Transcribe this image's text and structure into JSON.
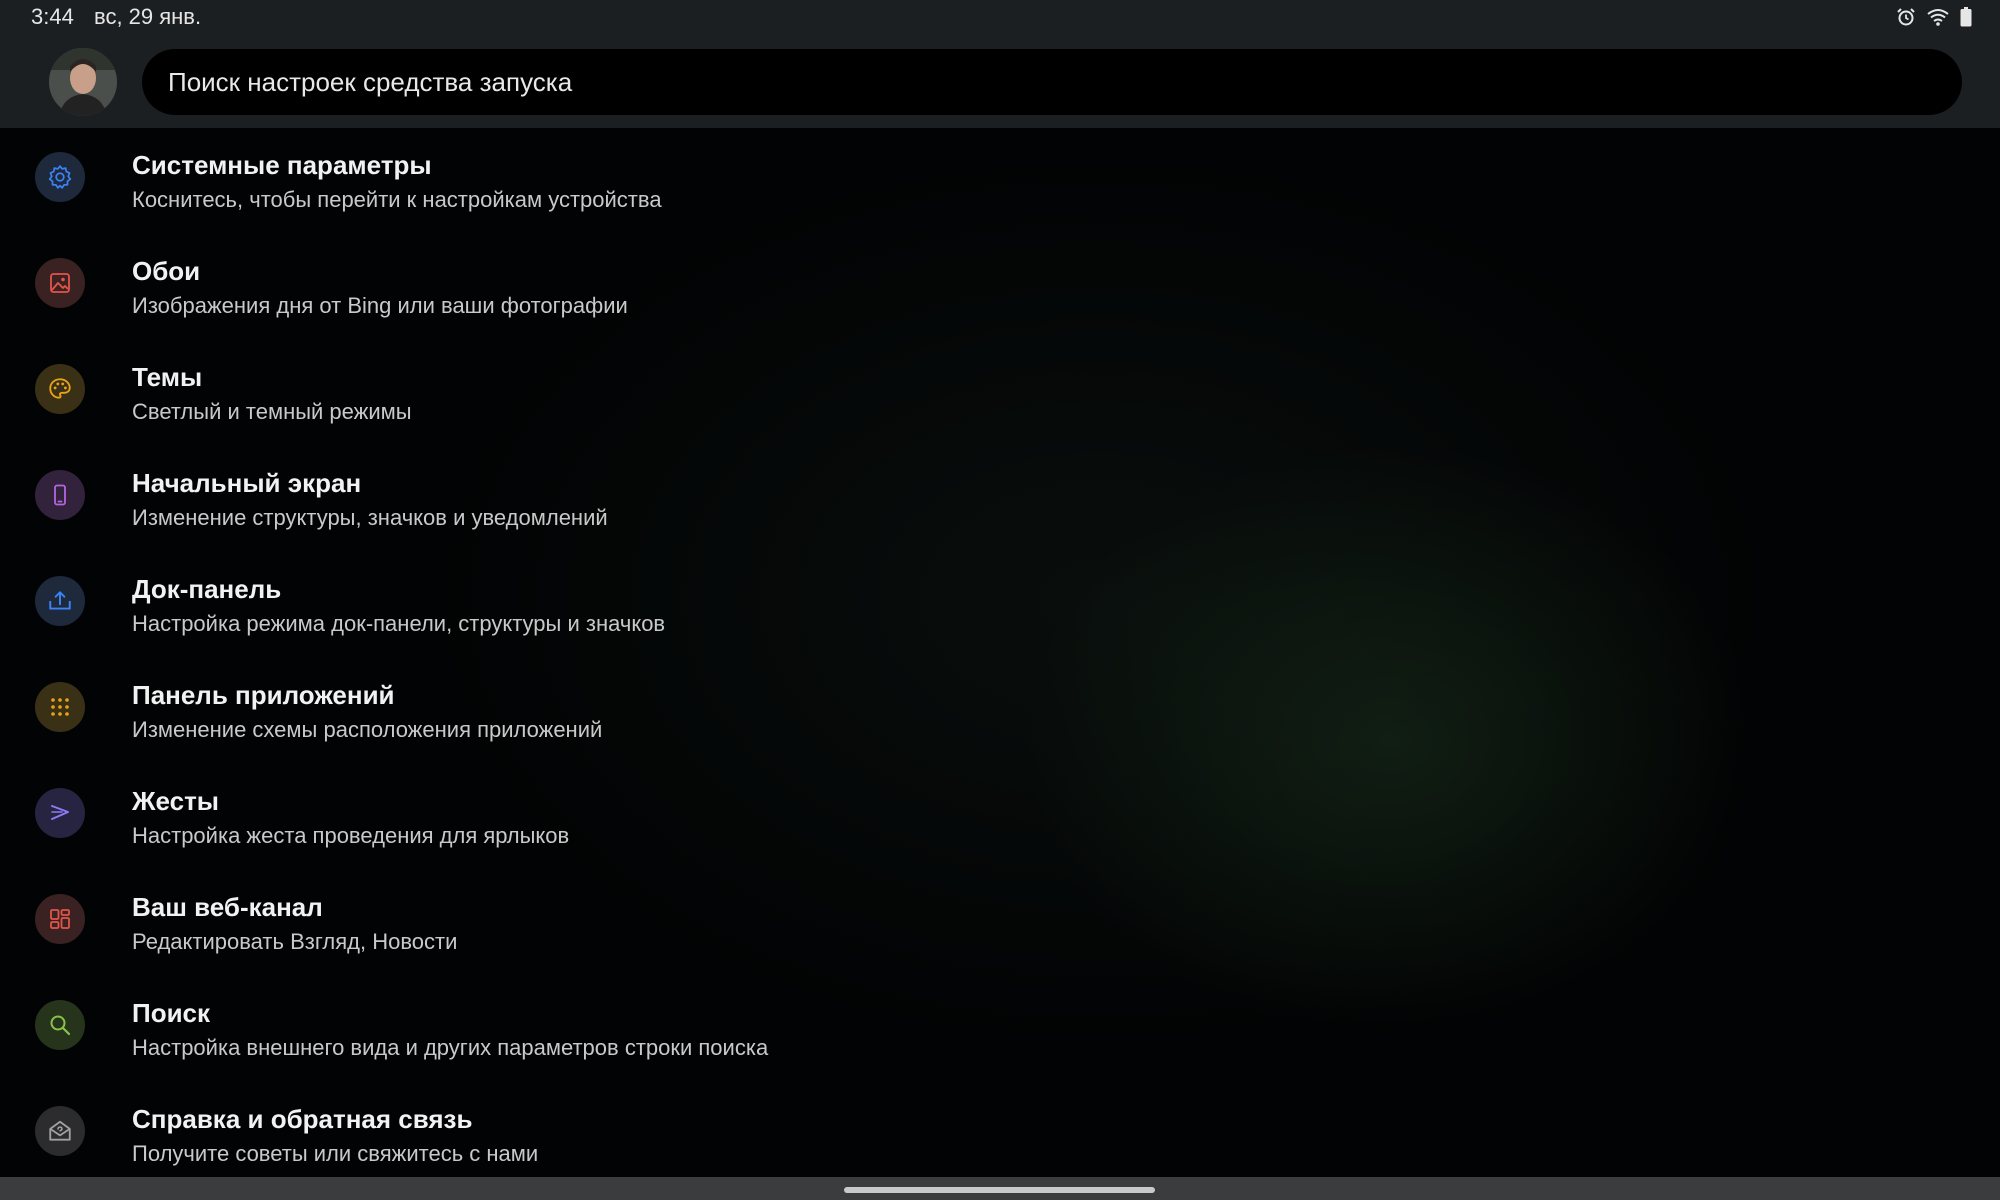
{
  "status_bar": {
    "time": "3:44",
    "date": "вс, 29 янв."
  },
  "search": {
    "placeholder": "Поиск настроек средства запуска"
  },
  "items": [
    {
      "title": "Системные параметры",
      "subtitle": "Коснитесь, чтобы перейти к настройкам устройства",
      "icon": "gear-icon",
      "color": "#3b82f6",
      "bg": "#1e2a3c"
    },
    {
      "title": "Обои",
      "subtitle": "Изображения дня от Bing или ваши фотографии",
      "icon": "image-icon",
      "color": "#e2554a",
      "bg": "#3a2222"
    },
    {
      "title": "Темы",
      "subtitle": "Светлый и темный режимы",
      "icon": "palette-icon",
      "color": "#e8a317",
      "bg": "#3a3016"
    },
    {
      "title": "Начальный экран",
      "subtitle": "Изменение структуры, значков и уведомлений",
      "icon": "phone-icon",
      "color": "#b366e0",
      "bg": "#32223c"
    },
    {
      "title": "Док-панель",
      "subtitle": "Настройка режима док-панели, структуры и значков",
      "icon": "upload-tray-icon",
      "color": "#3b82f6",
      "bg": "#1e2a3c"
    },
    {
      "title": "Панель приложений",
      "subtitle": "Изменение схемы расположения приложений",
      "icon": "grid-dots-icon",
      "color": "#e8a317",
      "bg": "#3a3016"
    },
    {
      "title": "Жесты",
      "subtitle": "Настройка жеста проведения для ярлыков",
      "icon": "gesture-icon",
      "color": "#8b7cf6",
      "bg": "#262440"
    },
    {
      "title": "Ваш веб-канал",
      "subtitle": "Редактировать Взгляд, Новости",
      "icon": "dashboard-icon",
      "color": "#e2554a",
      "bg": "#3a2222"
    },
    {
      "title": "Поиск",
      "subtitle": "Настройка внешнего вида и других параметров строки поиска",
      "icon": "search-icon",
      "color": "#8bc34a",
      "bg": "#27341c"
    },
    {
      "title": "Справка и обратная связь",
      "subtitle": "Получите советы или свяжитесь с нами",
      "icon": "help-envelope-icon",
      "color": "#a0a0a0",
      "bg": "#2c2c2e"
    }
  ]
}
